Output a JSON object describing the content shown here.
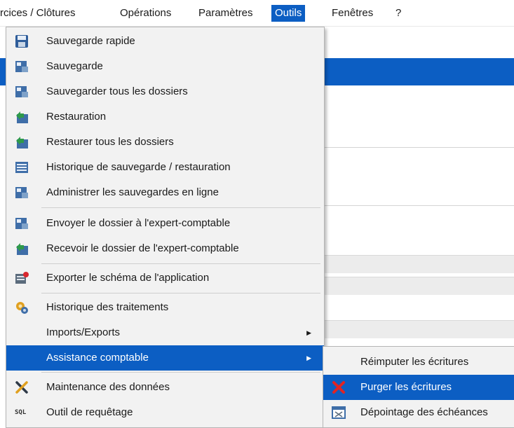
{
  "menubar": {
    "items": [
      "rcices / Clôtures",
      "Opérations",
      "Paramètres",
      "Outils",
      "Fenêtres",
      "?"
    ]
  },
  "menu": {
    "items": [
      {
        "label": "Sauvegarde rapide",
        "icon": "floppy-save-icon"
      },
      {
        "label": "Sauvegarde",
        "icon": "backup-icon"
      },
      {
        "label": "Sauvegarder tous les dossiers",
        "icon": "backup-all-icon"
      },
      {
        "label": "Restauration",
        "icon": "restore-icon"
      },
      {
        "label": "Restaurer tous les dossiers",
        "icon": "restore-all-icon"
      },
      {
        "label": "Historique de sauvegarde / restauration",
        "icon": "backup-history-icon"
      },
      {
        "label": "Administrer les sauvegardes en ligne",
        "icon": "online-backup-icon"
      },
      {
        "label": "Envoyer le dossier à l'expert-comptable",
        "icon": "send-folder-icon"
      },
      {
        "label": "Recevoir le dossier de l'expert-comptable",
        "icon": "receive-folder-icon"
      },
      {
        "label": "Exporter le schéma de l'application",
        "icon": "export-schema-icon"
      },
      {
        "label": "Historique des traitements",
        "icon": "processing-history-icon"
      },
      {
        "label": "Imports/Exports",
        "icon": ""
      },
      {
        "label": "Assistance comptable",
        "icon": ""
      },
      {
        "label": "Maintenance des données",
        "icon": "tools-icon"
      },
      {
        "label": "Outil de requêtage",
        "icon": "sql-icon",
        "icon_text": "SQL"
      }
    ]
  },
  "submenu": {
    "items": [
      {
        "label": "Réimputer les écritures",
        "icon": ""
      },
      {
        "label": "Purger les écritures",
        "icon": "purge-x-icon"
      },
      {
        "label": "Dépointage des échéances",
        "icon": "calendar-icon"
      }
    ]
  },
  "colors": {
    "highlight": "#0c5ec3",
    "menu_bg": "#f2f2f2"
  }
}
